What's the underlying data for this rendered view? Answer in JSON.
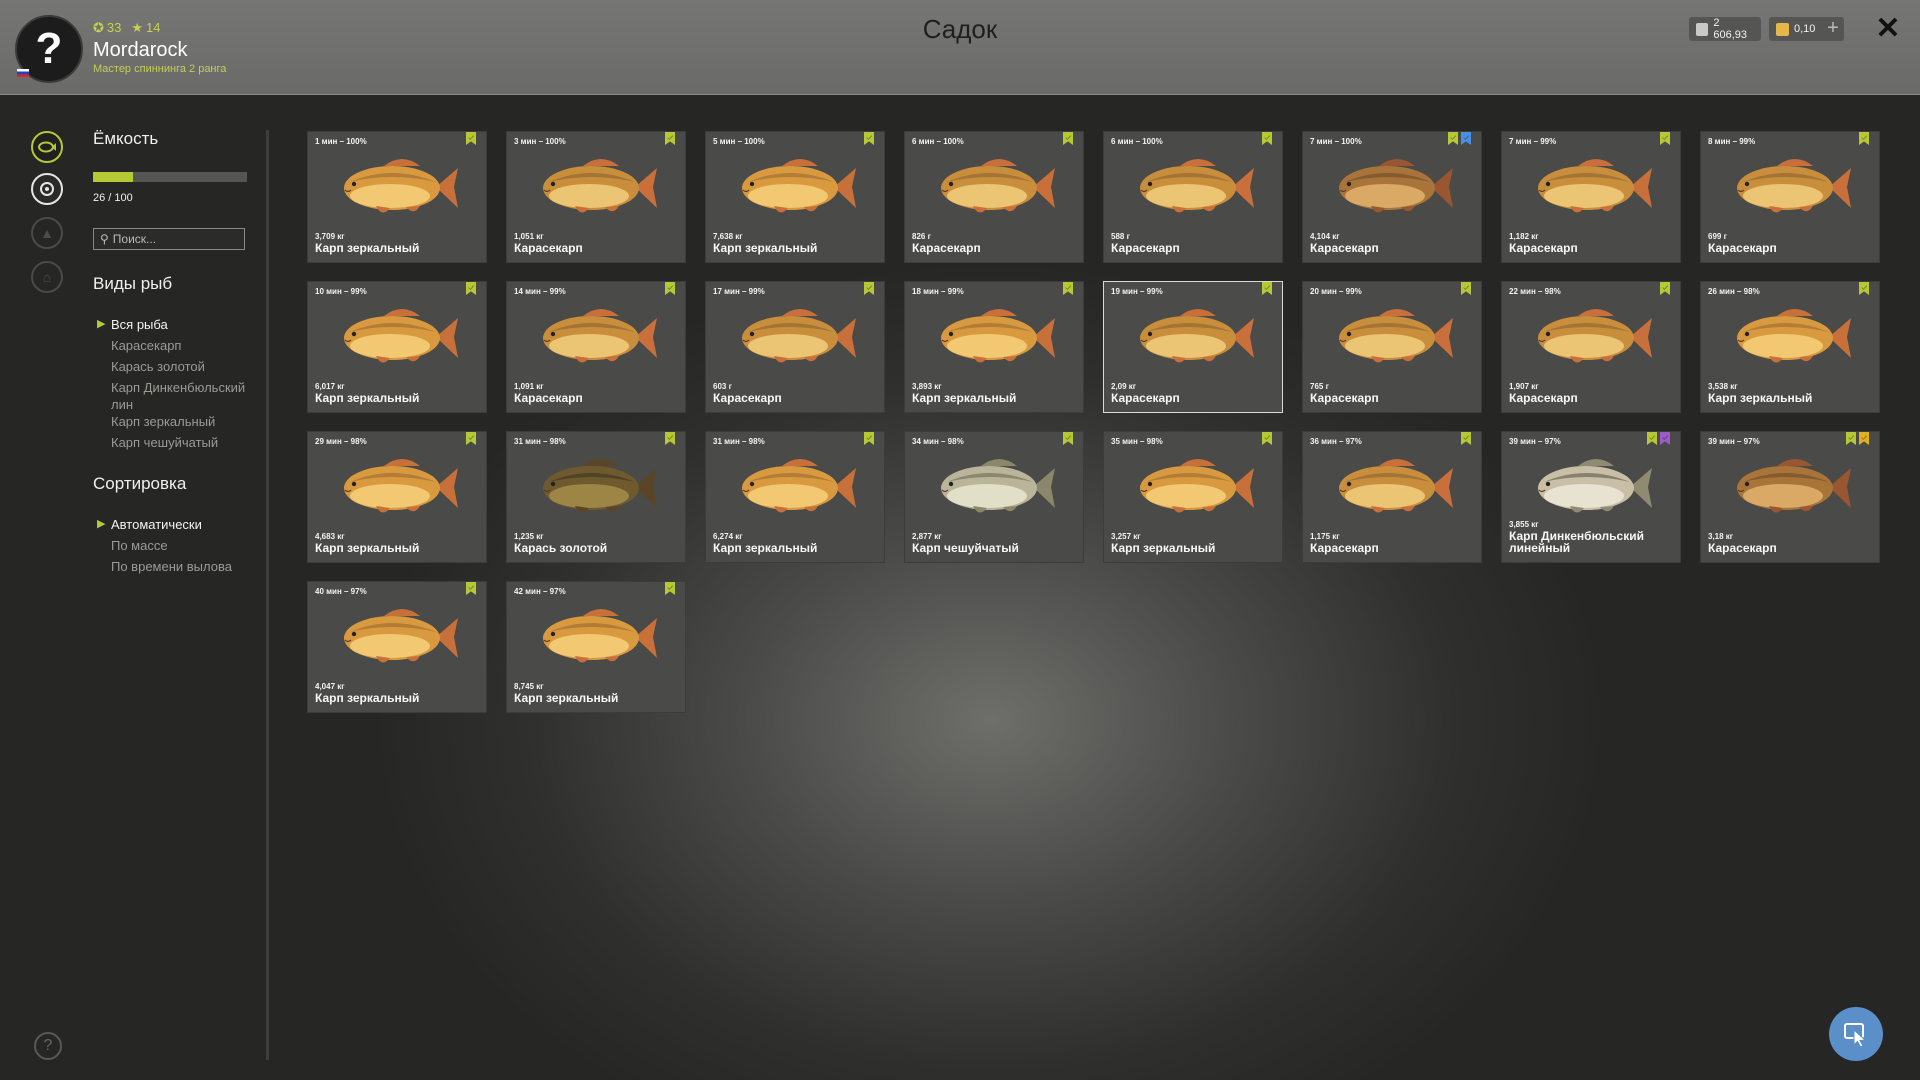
{
  "header": {
    "title": "Садок",
    "username": "Mordarock",
    "rank": "Мастер спиннинга 2 ранга",
    "level": "33",
    "stars": "14",
    "silver": "2 606,93",
    "gold": "0,10",
    "plus": "+",
    "close": "✕"
  },
  "sidebar": {
    "capacity_title": "Ёмкость",
    "capacity_value": "26 / 100",
    "capacity_fraction": 0.26,
    "search_placeholder": "Поиск...",
    "types_title": "Виды рыб",
    "types": [
      "Вся рыба",
      "Карасекарп",
      "Карась золотой",
      "Карп Динкенбюльский лин",
      "Карп зеркальный",
      "Карп чешуйчатый"
    ],
    "sort_title": "Сортировка",
    "sort": [
      "Автоматически",
      "По массе",
      "По времени вылова"
    ]
  },
  "colors": {
    "accent": "#b7c836",
    "tag_green": "#b7c836",
    "tag_blue": "#4a90e2",
    "tag_purple": "#9a5cc6",
    "tag_gold": "#e0b020"
  },
  "fish": [
    {
      "time": "1 мин – 100%",
      "weight": "3,709 кг",
      "name": "Карп зеркальный",
      "type": "mirror",
      "tags": [
        "green"
      ]
    },
    {
      "time": "3 мин – 100%",
      "weight": "1,051 кг",
      "name": "Карасекарп",
      "type": "crucian",
      "tags": [
        "green"
      ]
    },
    {
      "time": "5 мин – 100%",
      "weight": "7,638 кг",
      "name": "Карп зеркальный",
      "type": "mirror",
      "tags": [
        "green"
      ]
    },
    {
      "time": "6 мин – 100%",
      "weight": "826 г",
      "name": "Карасекарп",
      "type": "crucian",
      "tags": [
        "green"
      ]
    },
    {
      "time": "6 мин – 100%",
      "weight": "588 г",
      "name": "Карасекарп",
      "type": "crucian",
      "tags": [
        "green"
      ]
    },
    {
      "time": "7 мин – 100%",
      "weight": "4,104 кг",
      "name": "Карасекарп",
      "type": "crucianDark",
      "tags": [
        "green",
        "blue"
      ]
    },
    {
      "time": "7 мин – 99%",
      "weight": "1,182 кг",
      "name": "Карасекарп",
      "type": "crucian",
      "tags": [
        "green"
      ]
    },
    {
      "time": "8 мин – 99%",
      "weight": "699 г",
      "name": "Карасекарп",
      "type": "crucian",
      "tags": [
        "green"
      ]
    },
    {
      "time": "10 мин – 99%",
      "weight": "6,017 кг",
      "name": "Карп зеркальный",
      "type": "mirror",
      "tags": [
        "green"
      ]
    },
    {
      "time": "14 мин – 99%",
      "weight": "1,091 кг",
      "name": "Карасекарп",
      "type": "crucian",
      "tags": [
        "green"
      ]
    },
    {
      "time": "17 мин – 99%",
      "weight": "603 г",
      "name": "Карасекарп",
      "type": "crucian",
      "tags": [
        "green"
      ]
    },
    {
      "time": "18 мин – 99%",
      "weight": "3,893 кг",
      "name": "Карп зеркальный",
      "type": "mirror",
      "tags": [
        "green"
      ]
    },
    {
      "time": "19 мин – 99%",
      "weight": "2,09 кг",
      "name": "Карасекарп",
      "type": "crucian",
      "tags": [
        "green"
      ],
      "selected": true
    },
    {
      "time": "20 мин – 99%",
      "weight": "765 г",
      "name": "Карасекарп",
      "type": "crucian",
      "tags": [
        "green"
      ]
    },
    {
      "time": "22 мин – 98%",
      "weight": "1,907 кг",
      "name": "Карасекарп",
      "type": "crucian",
      "tags": [
        "green"
      ]
    },
    {
      "time": "26 мин – 98%",
      "weight": "3,538 кг",
      "name": "Карп зеркальный",
      "type": "mirror",
      "tags": [
        "green"
      ]
    },
    {
      "time": "29 мин – 98%",
      "weight": "4,683 кг",
      "name": "Карп зеркальный",
      "type": "mirror",
      "tags": [
        "green"
      ]
    },
    {
      "time": "31 мин – 98%",
      "weight": "1,235 кг",
      "name": "Карась золотой",
      "type": "goldfish",
      "tags": [
        "green"
      ]
    },
    {
      "time": "31 мин – 98%",
      "weight": "6,274 кг",
      "name": "Карп зеркальный",
      "type": "mirror",
      "tags": [
        "green"
      ]
    },
    {
      "time": "34 мин – 98%",
      "weight": "2,877 кг",
      "name": "Карп чешуйчатый",
      "type": "scaly",
      "tags": [
        "green"
      ]
    },
    {
      "time": "35 мин – 98%",
      "weight": "3,257 кг",
      "name": "Карп зеркальный",
      "type": "mirror",
      "tags": [
        "green"
      ]
    },
    {
      "time": "36 мин – 97%",
      "weight": "1,175 кг",
      "name": "Карасекарп",
      "type": "crucian",
      "tags": [
        "green"
      ]
    },
    {
      "time": "39 мин – 97%",
      "weight": "3,855 кг",
      "name": "Карп Динкенбюльский линейный",
      "type": "linear",
      "tags": [
        "green",
        "purple"
      ]
    },
    {
      "time": "39 мин – 97%",
      "weight": "3,18 кг",
      "name": "Карасекарп",
      "type": "crucianDark",
      "tags": [
        "green",
        "gold"
      ]
    },
    {
      "time": "40 мин – 97%",
      "weight": "4,047 кг",
      "name": "Карп зеркальный",
      "type": "mirror",
      "tags": [
        "green"
      ]
    },
    {
      "time": "42 мин – 97%",
      "weight": "8,745 кг",
      "name": "Карп зеркальный",
      "type": "mirror",
      "tags": [
        "green"
      ]
    }
  ]
}
